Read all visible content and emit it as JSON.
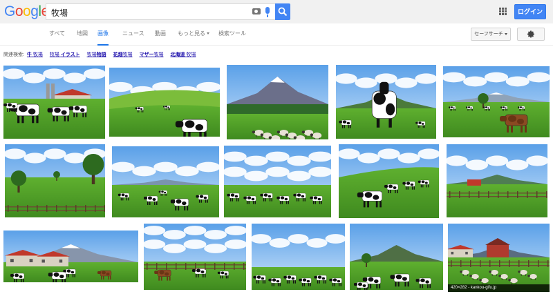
{
  "header": {
    "logo": [
      "G",
      "o",
      "o",
      "g",
      "l",
      "e"
    ],
    "logo_colors": [
      "#4285f4",
      "#ea4335",
      "#fbbc05",
      "#4285f4",
      "#34a853",
      "#ea4335"
    ],
    "query": "牧場",
    "login_label": "ログイン"
  },
  "tabs": [
    {
      "label": "すべて",
      "active": false
    },
    {
      "label": "地図",
      "active": false
    },
    {
      "label": "画像",
      "active": true
    },
    {
      "label": "ニュース",
      "active": false
    },
    {
      "label": "動画",
      "active": false
    },
    {
      "label": "もっと見る",
      "active": false,
      "dropdown": true
    },
    {
      "label": "検索ツール",
      "active": false
    }
  ],
  "safe_search_label": "セーフサーチ",
  "related": {
    "label": "関連検索:",
    "items": [
      {
        "bold": "牛",
        "rest": " 牧場"
      },
      {
        "bold": "",
        "rest": "牧場 ",
        "bold2": "イラスト"
      },
      {
        "bold": "",
        "rest": "牧場",
        "bold2": "物語"
      },
      {
        "bold": "花畑",
        "rest": "牧場"
      },
      {
        "bold": "マザー",
        "rest": "牧場"
      },
      {
        "bold": "北海道",
        "rest": " 牧場"
      }
    ]
  },
  "images": [
    {
      "scene": "cows_barn"
    },
    {
      "scene": "cow_hill"
    },
    {
      "scene": "fuji_sheep"
    },
    {
      "scene": "cow_front"
    },
    {
      "scene": "brown_cow"
    },
    {
      "scene": "tree_fence"
    },
    {
      "scene": "cows_plain"
    },
    {
      "scene": "cows_sky"
    },
    {
      "scene": "cow_slope"
    },
    {
      "scene": "red_barn_field"
    },
    {
      "scene": "barn_mountain"
    },
    {
      "scene": "cows_clouds"
    },
    {
      "scene": "cows_bluesky"
    },
    {
      "scene": "cows_mountain2"
    },
    {
      "scene": "sheep_barn",
      "caption": "420×282 - kankou-gifu.jp"
    }
  ],
  "colors": {
    "accent": "#1a73e8",
    "link": "#1a0dab",
    "login": "#4285f4"
  }
}
